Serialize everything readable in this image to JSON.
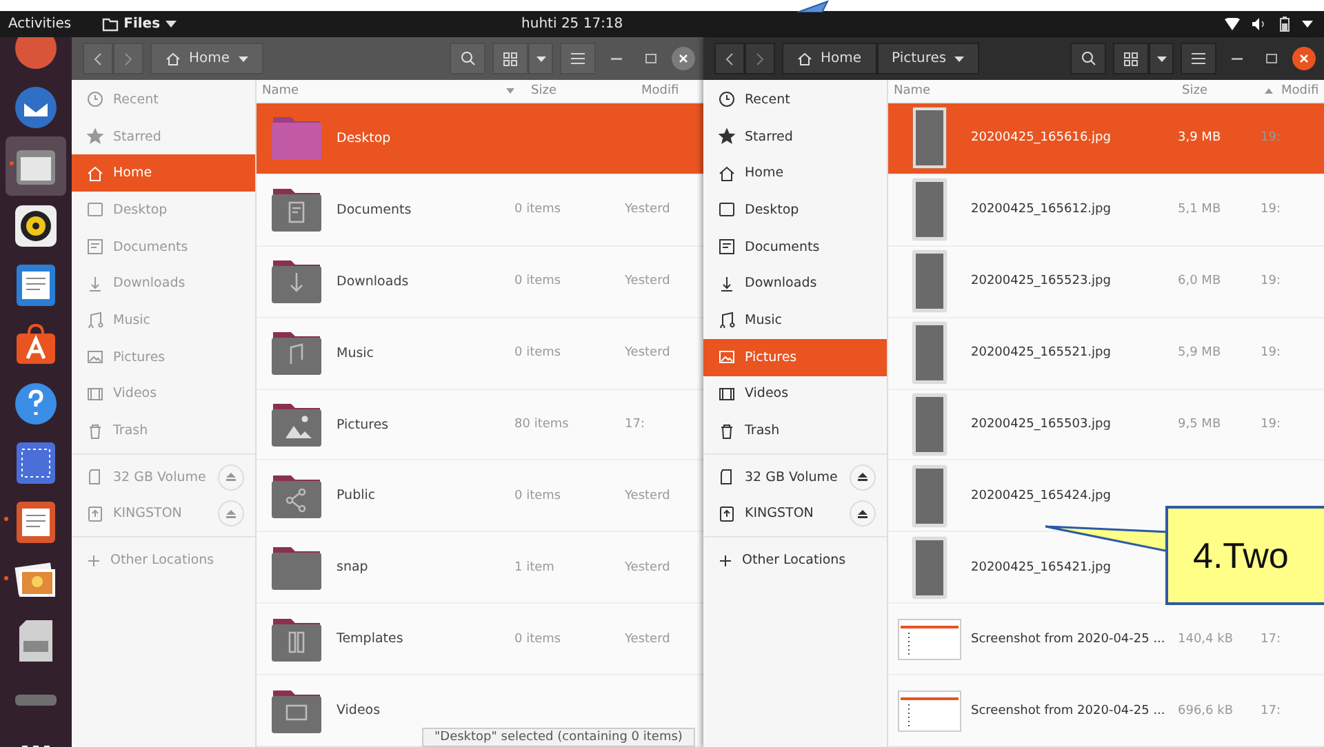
{
  "top_bar": {
    "activities": "Activities",
    "app_menu": "Files",
    "clock": "huhti 25  17:18"
  },
  "dock": [
    {
      "kind": "browser",
      "running": false
    },
    {
      "kind": "mail",
      "running": false
    },
    {
      "kind": "files",
      "running": true
    },
    {
      "kind": "music",
      "running": false
    },
    {
      "kind": "writer",
      "running": false
    },
    {
      "kind": "software",
      "running": false
    },
    {
      "kind": "help",
      "running": false
    },
    {
      "kind": "screenshot",
      "running": false
    },
    {
      "kind": "impress",
      "running": true
    },
    {
      "kind": "photos",
      "running": true
    },
    {
      "kind": "card",
      "running": false
    },
    {
      "kind": "drive",
      "running": false
    },
    {
      "kind": "grid",
      "running": false
    }
  ],
  "windows": [
    {
      "active": false,
      "path": [
        "Home"
      ],
      "sidebar": {
        "places": [
          {
            "label": "Recent",
            "selected": false
          },
          {
            "label": "Starred",
            "selected": false
          },
          {
            "label": "Home",
            "selected": true
          },
          {
            "label": "Desktop",
            "selected": false
          },
          {
            "label": "Documents",
            "selected": false
          },
          {
            "label": "Downloads",
            "selected": false
          },
          {
            "label": "Music",
            "selected": false
          },
          {
            "label": "Pictures",
            "selected": false
          },
          {
            "label": "Videos",
            "selected": false
          },
          {
            "label": "Trash",
            "selected": false
          }
        ],
        "devices": [
          {
            "label": "32 GB Volume"
          },
          {
            "label": "KINGSTON"
          }
        ],
        "other": "Other Locations"
      },
      "columns": [
        {
          "label": "Name",
          "sorted": true
        },
        {
          "label": "Size",
          "sorted": false
        },
        {
          "label": "Modifi",
          "sorted": false
        }
      ],
      "rows": [
        {
          "name": "Desktop",
          "size": "",
          "modified": "",
          "kind": "desktop",
          "selected": true
        },
        {
          "name": "Documents",
          "size": "0 items",
          "modified": "Yesterd",
          "kind": "documents",
          "selected": false
        },
        {
          "name": "Downloads",
          "size": "0 items",
          "modified": "Yesterd",
          "kind": "downloads",
          "selected": false
        },
        {
          "name": "Music",
          "size": "0 items",
          "modified": "Yesterd",
          "kind": "music",
          "selected": false
        },
        {
          "name": "Pictures",
          "size": "80 items",
          "modified": "17:",
          "kind": "pictures",
          "selected": false
        },
        {
          "name": "Public",
          "size": "0 items",
          "modified": "Yesterd",
          "kind": "public",
          "selected": false
        },
        {
          "name": "snap",
          "size": "1 item",
          "modified": "Yesterd",
          "kind": "plain",
          "selected": false
        },
        {
          "name": "Templates",
          "size": "0 items",
          "modified": "Yesterd",
          "kind": "templates",
          "selected": false
        },
        {
          "name": "Videos",
          "size": "",
          "modified": "",
          "kind": "videos",
          "selected": false
        }
      ],
      "status": "\"Desktop\" selected  (containing 0 items)"
    },
    {
      "active": true,
      "path": [
        "Home",
        "Pictures"
      ],
      "sidebar": {
        "places": [
          {
            "label": "Recent",
            "selected": false
          },
          {
            "label": "Starred",
            "selected": false
          },
          {
            "label": "Home",
            "selected": false
          },
          {
            "label": "Desktop",
            "selected": false
          },
          {
            "label": "Documents",
            "selected": false
          },
          {
            "label": "Downloads",
            "selected": false
          },
          {
            "label": "Music",
            "selected": false
          },
          {
            "label": "Pictures",
            "selected": true
          },
          {
            "label": "Videos",
            "selected": false
          },
          {
            "label": "Trash",
            "selected": false
          }
        ],
        "devices": [
          {
            "label": "32 GB Volume"
          },
          {
            "label": "KINGSTON"
          }
        ],
        "other": "Other Locations"
      },
      "columns": [
        {
          "label": "Name",
          "sorted": false
        },
        {
          "label": "Size",
          "sorted": false
        },
        {
          "label": "Modifi",
          "sorted": true
        }
      ],
      "rows": [
        {
          "name": "20200425_165616.jpg",
          "size": "3,9 MB",
          "modified": "19:",
          "kind": "photo",
          "selected": true
        },
        {
          "name": "20200425_165612.jpg",
          "size": "5,1 MB",
          "modified": "19:",
          "kind": "photo",
          "selected": false
        },
        {
          "name": "20200425_165523.jpg",
          "size": "6,0 MB",
          "modified": "19:",
          "kind": "photo",
          "selected": false
        },
        {
          "name": "20200425_165521.jpg",
          "size": "5,9 MB",
          "modified": "19:",
          "kind": "photo",
          "selected": false
        },
        {
          "name": "20200425_165503.jpg",
          "size": "9,5 MB",
          "modified": "19:",
          "kind": "photo",
          "selected": false
        },
        {
          "name": "20200425_165424.jpg",
          "size": "",
          "modified": "",
          "kind": "photo",
          "selected": false
        },
        {
          "name": "20200425_165421.jpg",
          "size": "",
          "modified": "",
          "kind": "photo",
          "selected": false
        },
        {
          "name": "Screenshot from 2020-04-25 ...",
          "size": "140,4 kB",
          "modified": "17:",
          "kind": "screenshot",
          "selected": false
        },
        {
          "name": "Screenshot from 2020-04-25 ...",
          "size": "696,6 kB",
          "modified": "17:",
          "kind": "screenshot",
          "selected": false
        }
      ]
    }
  ],
  "callout": {
    "text": "4.Two"
  }
}
